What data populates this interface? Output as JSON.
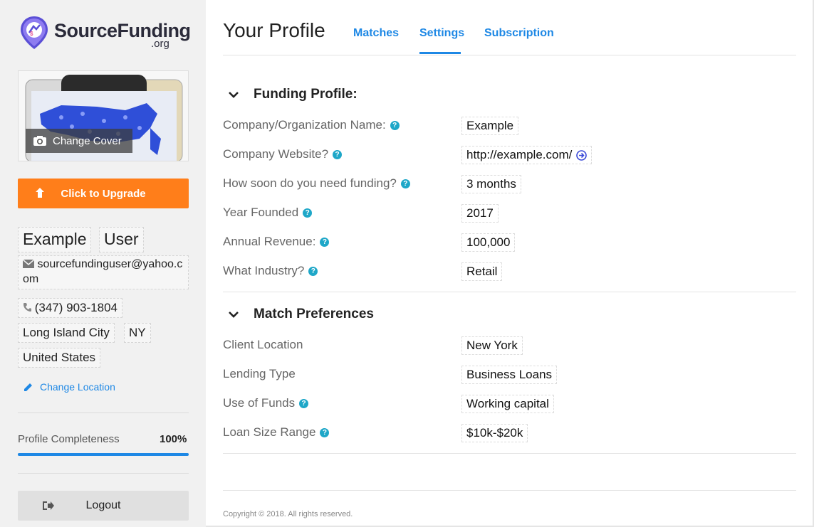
{
  "brand": {
    "name": "SourceFunding",
    "suffix": ".org",
    "pin_color": "#5b4fd6",
    "accent": "#1e88e5",
    "upgrade_color": "#ff7e1a"
  },
  "sidebar": {
    "change_cover_label": "Change Cover",
    "upgrade_label": "Click to Upgrade",
    "first_name": "Example",
    "last_name": "User",
    "email": "sourcefundinguser@yahoo.com",
    "phone": "(347) 903-1804",
    "city": "Long Island City",
    "state": "NY",
    "country": "United States",
    "change_location_label": "Change Location",
    "completeness_label": "Profile Completeness",
    "completeness_value": "100%",
    "completeness_fraction": 1.0,
    "logout_label": "Logout"
  },
  "header": {
    "title": "Your Profile",
    "tabs": [
      {
        "label": "Matches",
        "active": false
      },
      {
        "label": "Settings",
        "active": true
      },
      {
        "label": "Subscription",
        "active": false
      }
    ]
  },
  "funding_profile": {
    "heading": "Funding Profile:",
    "rows": [
      {
        "label": "Company/Organization Name:",
        "value": "Example",
        "help": true
      },
      {
        "label": "Company Website?",
        "value": "http://example.com/",
        "help": true,
        "link_icon": true
      },
      {
        "label": "How soon do you need funding?",
        "value": "3 months",
        "help": true
      },
      {
        "label": "Year Founded",
        "value": "2017",
        "help": true
      },
      {
        "label": "Annual Revenue:",
        "value": "100,000",
        "help": true
      },
      {
        "label": "What Industry?",
        "value": "Retail",
        "help": true
      }
    ]
  },
  "match_preferences": {
    "heading": "Match Preferences",
    "rows": [
      {
        "label": "Client Location",
        "value": "New York",
        "help": false
      },
      {
        "label": "Lending Type",
        "value": "Business Loans",
        "help": false
      },
      {
        "label": "Use of Funds",
        "value": "Working capital",
        "help": true
      },
      {
        "label": "Loan Size Range",
        "value": "$10k-$20k",
        "help": true
      }
    ]
  },
  "footer": {
    "copyright": "Copyright © 2018. All rights reserved."
  },
  "icons": {
    "help": "question-circle-icon",
    "camera": "camera-icon",
    "upgrade": "arrow-up-icon",
    "email": "envelope-icon",
    "phone": "phone-icon",
    "edit": "pencil-icon",
    "logout": "sign-out-icon",
    "collapse": "chevron-down-icon",
    "link": "arrow-circle-right-icon"
  }
}
